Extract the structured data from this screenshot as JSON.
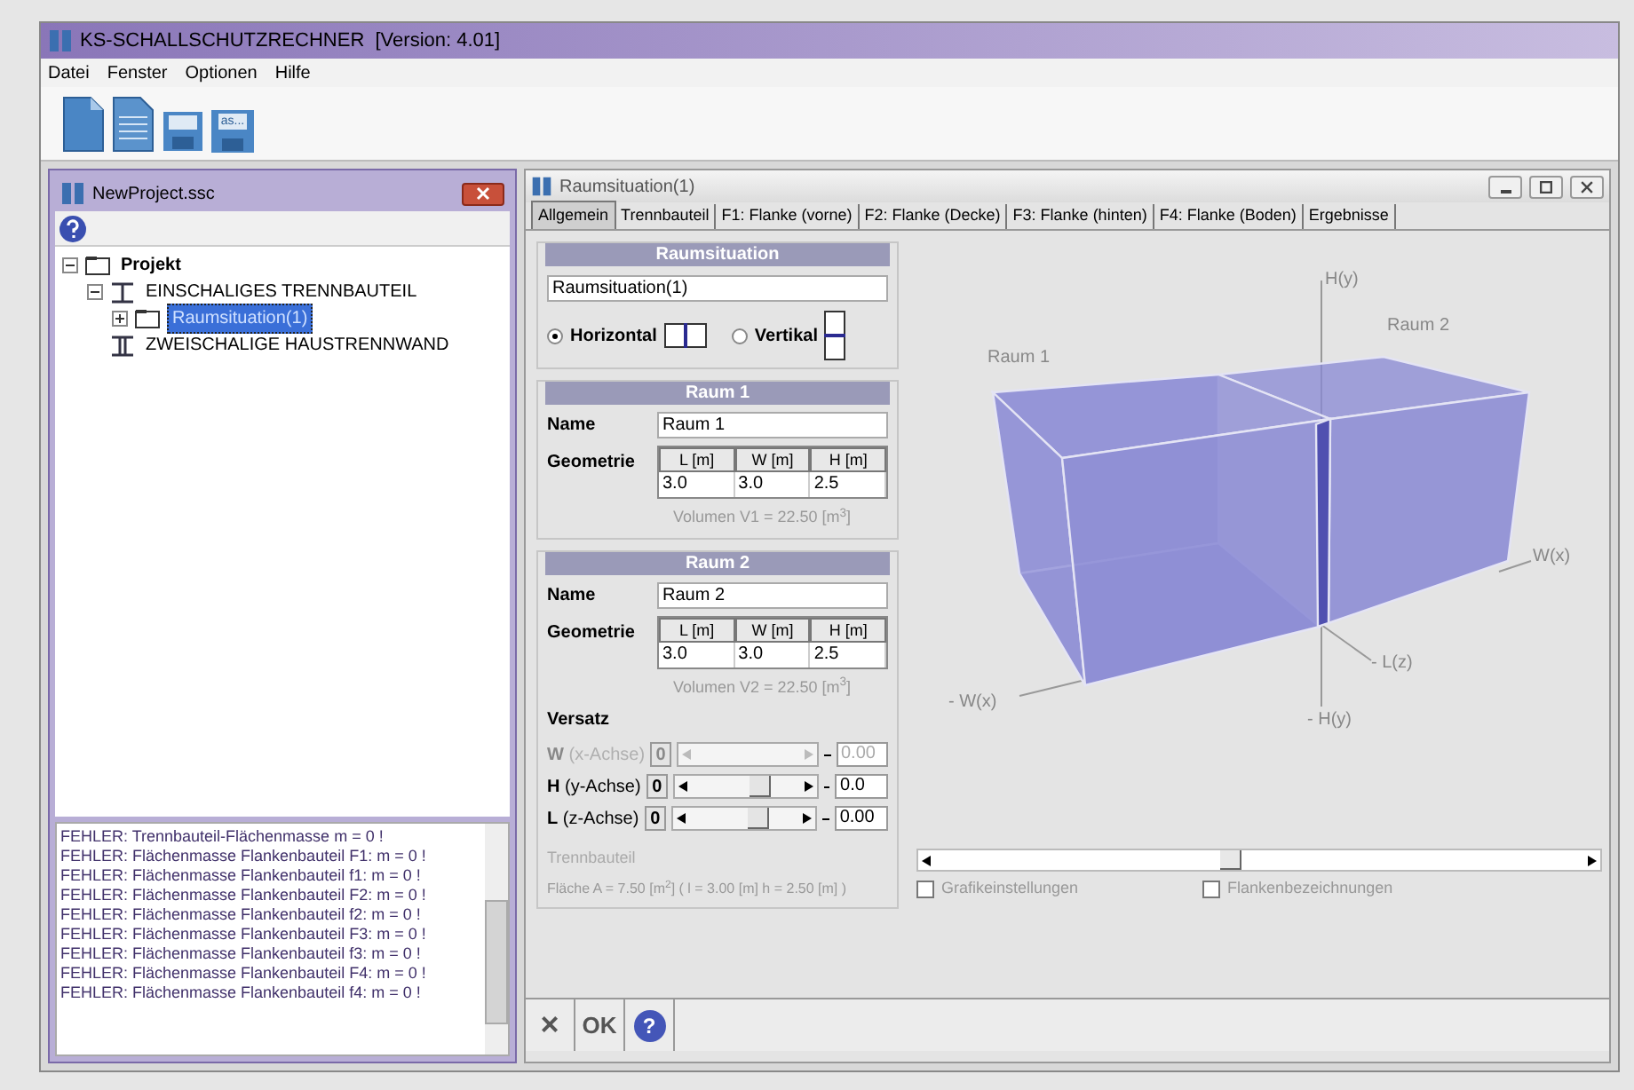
{
  "window": {
    "title": "KS-SCHALLSCHUTZRECHNER  [Version: 4.01]"
  },
  "menu": [
    "Datei",
    "Fenster",
    "Optionen",
    "Hilfe"
  ],
  "toolbar": [
    {
      "kind": "new"
    },
    {
      "kind": "document"
    },
    {
      "kind": "save"
    },
    {
      "kind": "save_as",
      "text": "as..."
    }
  ],
  "project_window": {
    "title": "NewProject.ssc",
    "tree": [
      {
        "label": "Projekt",
        "kind": "folder",
        "expanded": true,
        "selected": false,
        "children": [
          {
            "label": "EINSCHALIGES TRENNBAUTEIL",
            "kind": "single_wall",
            "expanded": true,
            "selected": false,
            "children": [
              {
                "label": "Raumsituation(1)",
                "kind": "folder",
                "expanded": false,
                "selected": true
              }
            ]
          },
          {
            "label": "ZWEISCHALIGE HAUSTRENNWAND",
            "kind": "double_wall",
            "selected": false
          }
        ]
      }
    ],
    "log": [
      "FEHLER: Trennbauteil-Flächenmasse m = 0 !",
      "FEHLER: Flächenmasse Flankenbauteil F1: m = 0 !",
      "FEHLER: Flächenmasse Flankenbauteil f1: m = 0 !",
      "FEHLER: Flächenmasse Flankenbauteil F2: m = 0 !",
      "FEHLER: Flächenmasse Flankenbauteil f2: m = 0 !",
      "FEHLER: Flächenmasse Flankenbauteil F3: m = 0 !",
      "FEHLER: Flächenmasse Flankenbauteil f3: m = 0 !",
      "FEHLER: Flächenmasse Flankenbauteil F4: m = 0 !",
      "FEHLER: Flächenmasse Flankenbauteil f4: m = 0 !"
    ]
  },
  "editor": {
    "title": "Raumsituation(1)",
    "tabs": [
      {
        "label": "Allgemein",
        "selected": true
      },
      {
        "label": "Trennbauteil",
        "selected": false
      },
      {
        "label": "F1: Flanke (vorne)",
        "selected": false
      },
      {
        "label": "F2: Flanke (Decke)",
        "selected": false
      },
      {
        "label": "F3: Flanke (hinten)",
        "selected": false
      },
      {
        "label": "F4: Flanke (Boden)",
        "selected": false
      },
      {
        "label": "Ergebnisse",
        "selected": false
      }
    ],
    "situation": {
      "header": "Raumsituation",
      "name": "Raumsituation(1)",
      "options": [
        {
          "label": "Horizontal",
          "kind": "horizontal",
          "selected": true
        },
        {
          "label": "Vertikal",
          "kind": "vertical",
          "selected": false
        }
      ]
    },
    "rooms": [
      {
        "header": "Raum 1",
        "name_label": "Name",
        "name": "Raum 1",
        "geometry_label": "Geometrie",
        "columns": [
          "L [m]",
          "W [m]",
          "H [m]"
        ],
        "values": [
          "3.0",
          "3.0",
          "2.5"
        ],
        "volume": "Volumen V1 = 22.50 [m$^{3}$]"
      },
      {
        "header": "Raum 2",
        "name_label": "Name",
        "name": "Raum 2",
        "geometry_label": "Geometrie",
        "columns": [
          "L [m]",
          "W [m]",
          "H [m]"
        ],
        "values": [
          "3.0",
          "3.0",
          "2.5"
        ],
        "volume": "Volumen V2 = 22.50 [m$^{3}$]"
      }
    ],
    "offset": {
      "title": "Versatz",
      "rows": [
        {
          "axis": "W",
          "axis_label": "(x-Achse)",
          "min": "0",
          "value": "0.00",
          "disabled": true
        },
        {
          "axis": "H",
          "axis_label": "(y-Achse)",
          "min": "0",
          "value": "0.0",
          "disabled": false
        },
        {
          "axis": "L",
          "axis_label": "(z-Achse)",
          "min": "0",
          "value": "0.00",
          "disabled": false
        }
      ]
    },
    "partition": {
      "title": "Trennbauteil",
      "area": "Fläche A = 7.50 [m$^{2}$] ( l = 3.00 [m] h = 2.50 [m] )"
    },
    "view_labels": [
      "H(y)",
      "Raum 2",
      "Raum 1",
      "W(x)",
      "- L(z)",
      "- W(x)",
      "- H(y)"
    ],
    "view_options": [
      {
        "label": "Grafikeinstellungen",
        "checked": false
      },
      {
        "label": "Flankenbezeichnungen",
        "checked": false
      }
    ],
    "actions": [
      {
        "kind": "cancel",
        "text": "×"
      },
      {
        "kind": "ok",
        "text": "OK"
      },
      {
        "kind": "help",
        "text": "?"
      }
    ]
  }
}
